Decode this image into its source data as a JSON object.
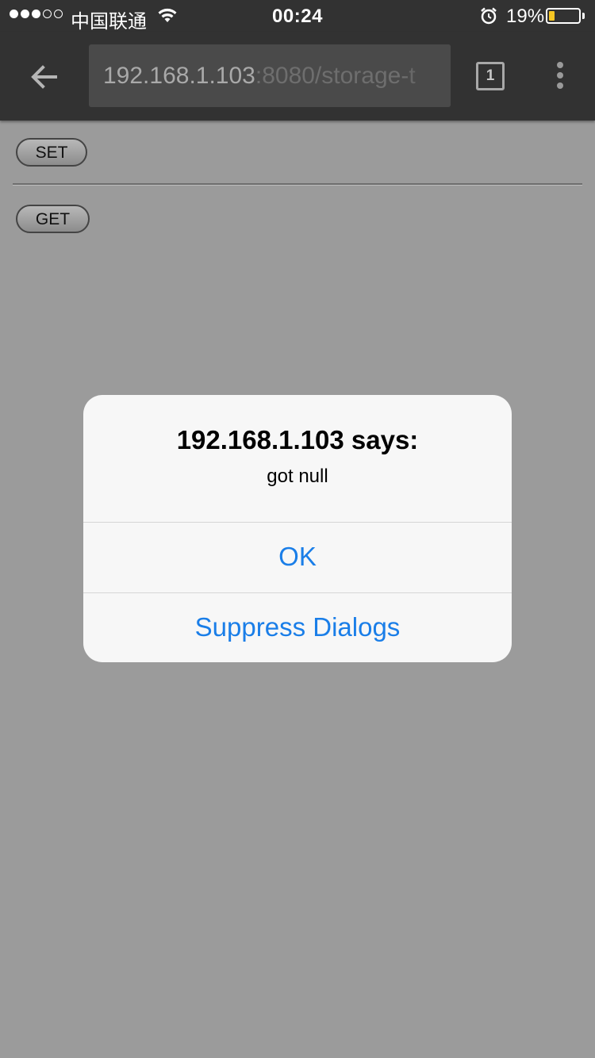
{
  "status_bar": {
    "signal_dots": [
      true,
      true,
      true,
      false,
      false
    ],
    "carrier": "中国联通",
    "time": "00:24",
    "battery_percent": "19%",
    "battery_level": 0.19,
    "battery_color": "#f6c623"
  },
  "toolbar": {
    "back_icon": "arrow-left-icon",
    "url_host": "192.168.1.103",
    "url_rest": ":8080/storage-t",
    "tab_count": "1",
    "menu_icon": "overflow-menu-icon"
  },
  "page": {
    "set_label": "SET",
    "get_label": "GET"
  },
  "dialog": {
    "title": "192.168.1.103 says:",
    "message": "got null",
    "ok_label": "OK",
    "suppress_label": "Suppress Dialogs",
    "accent": "#1a7ee8"
  }
}
